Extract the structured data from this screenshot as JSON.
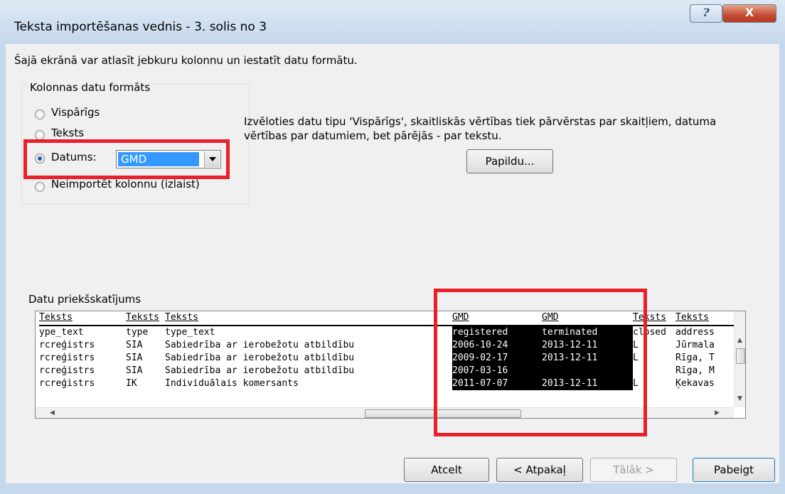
{
  "window": {
    "title": "Teksta importēšanas vednis - 3. solis no 3",
    "help_label": "?",
    "close_label": "X"
  },
  "intro_text": "Šajā ekrānā var atlasīt jebkuru kolonnu un iestatīt datu formātu.",
  "column_format": {
    "group_label": "Kolonnas datu formāts",
    "options": [
      {
        "label": "Vispārīgs",
        "selected": false
      },
      {
        "label": "Teksts",
        "selected": false
      },
      {
        "label": "Datums:",
        "selected": true
      },
      {
        "label": "Neimportēt kolonnu (izlaist)",
        "selected": false
      }
    ],
    "date_format_value": "GMD"
  },
  "description": {
    "line1": "Izvēloties datu tipu 'Vispārīgs', skaitliskās vērtības tiek pārvērstas par skaitļiem, datuma",
    "line2": "vērtības par datumiem, bet pārējās - par tekstu."
  },
  "advanced_button": "Papildu...",
  "preview": {
    "label": "Datu priekšskatījums",
    "headers": [
      "Teksts",
      "Teksts",
      "Teksts",
      "GMD",
      "GMD",
      "Teksts",
      "Teksts"
    ],
    "rows": [
      [
        "ype_text",
        "type",
        "type_text",
        "registered",
        "terminated",
        "closed",
        "address"
      ],
      [
        "rcreģistrs",
        "SIA",
        "Sabiedrība ar ierobežotu atbildību",
        "2006-10-24",
        "2013-12-11",
        "L",
        "Jūrmala"
      ],
      [
        "rcreģistrs",
        "SIA",
        "Sabiedrība ar ierobežotu atbildību",
        "2009-02-17",
        "2013-12-11",
        "L",
        "Rīga, T"
      ],
      [
        "rcreģistrs",
        "SIA",
        "Sabiedrība ar ierobežotu atbildību",
        "2007-03-16",
        "",
        "",
        "Rīga, M"
      ],
      [
        "rcreģistrs",
        "IK",
        "Individuālais komersants",
        "2011-07-07",
        "2013-12-11",
        "L",
        "Ķekavas"
      ]
    ]
  },
  "buttons": {
    "cancel": "Atcelt",
    "back": "< Atpakaļ",
    "next": "Tālāk >",
    "finish": "Pabeigt"
  },
  "colors": {
    "highlight": "#e8202a",
    "selection": "#3399ff"
  }
}
